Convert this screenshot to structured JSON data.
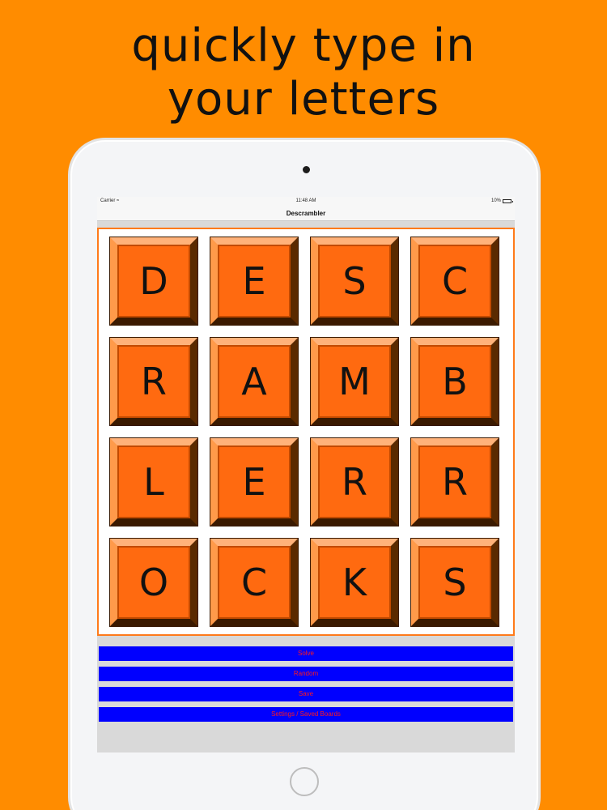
{
  "headline": {
    "line1": "quickly type in",
    "line2": "your letters"
  },
  "statusbar": {
    "carrier": "Carrier",
    "time": "11:48 AM",
    "battery": "10%"
  },
  "navbar": {
    "title": "Descrambler"
  },
  "board": {
    "tiles": [
      "D",
      "E",
      "S",
      "C",
      "R",
      "A",
      "M",
      "B",
      "L",
      "E",
      "R",
      "R",
      "O",
      "C",
      "K",
      "S"
    ]
  },
  "buttons": {
    "solve": "Solve",
    "random": "Random",
    "save": "Save",
    "settings": "Settings / Saved Boards"
  },
  "colors": {
    "background": "#ff8c00",
    "tile": "#ff6a10",
    "button": "#0000ff",
    "button_text": "#ff1a1a"
  }
}
